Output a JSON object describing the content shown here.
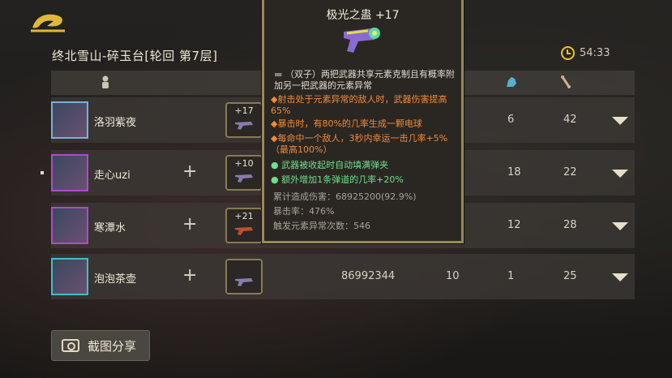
{
  "location": "终北雪山-碎玉台[轮回 第7层]",
  "timer": "54:33",
  "share_label": "截图分享",
  "colors": {
    "gold": "#e8c42a",
    "effect_orange": "#f08a3a",
    "effect_green": "#6ee08a"
  },
  "players": [
    {
      "name": "洛羽紫夜",
      "weapon_level": "+17",
      "damage": "",
      "kills": "",
      "deaths": "6",
      "assists": "42",
      "border": "#7ab0d8",
      "show_plus": false
    },
    {
      "name": "走心uzi",
      "weapon_level": "+10",
      "damage": "",
      "kills": "",
      "deaths": "18",
      "assists": "22",
      "border": "#b04ad0",
      "show_plus": true
    },
    {
      "name": "寒潭水",
      "weapon_level": "+21",
      "damage": "",
      "kills": "",
      "deaths": "12",
      "assists": "28",
      "border": "#b04ad0",
      "show_plus": true
    },
    {
      "name": "泡泡茶壶",
      "weapon_level": "",
      "damage": "86992344",
      "kills": "10",
      "deaths": "1",
      "assists": "25",
      "border": "#40c0c8",
      "show_plus": true
    }
  ],
  "tooltip": {
    "title": "极光之蛊 +17",
    "description": "（双子）两把武器共享元素克制且有概率附加另一把武器的元素异常",
    "effects": [
      {
        "text": "射击处于元素异常的敌人时，武器伤害提高65%",
        "color": "orange"
      },
      {
        "text": "暴击时，有80%的几率生成一颗电球",
        "color": "orange"
      },
      {
        "text": "每命中一个敌人，3秒内幸运一击几率+5%（最高100%）",
        "color": "orange"
      },
      {
        "text": "武器被收起时自动填满弹夹",
        "color": "green"
      },
      {
        "text": "额外增加1条弹道的几率+20%",
        "color": "green"
      }
    ],
    "stats": [
      "累计造成伤害：68925200(92.9%)",
      "暴击率：476%",
      "触发元素异常次数：546"
    ]
  }
}
